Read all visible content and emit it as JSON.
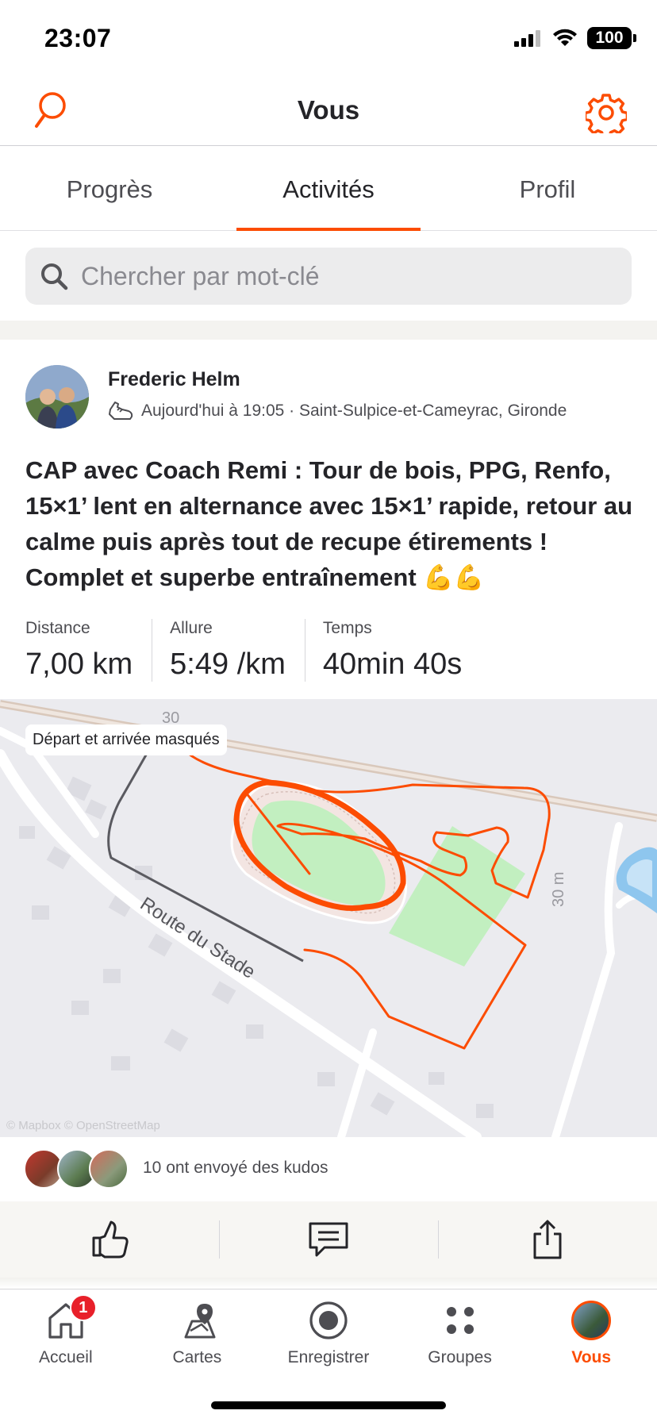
{
  "status_bar": {
    "time": "23:07",
    "battery": "100"
  },
  "header": {
    "title": "Vous"
  },
  "tabs": [
    {
      "label": "Progrès"
    },
    {
      "label": "Activités"
    },
    {
      "label": "Profil"
    }
  ],
  "search": {
    "placeholder": "Chercher par mot-clé"
  },
  "activity": {
    "athlete": "Frederic Helm",
    "meta": "Aujourd'hui à 19:05 · Saint-Sulpice-et-Cameyrac, Gironde",
    "title": "CAP avec Coach Remi : Tour de bois, PPG, Renfo, 15×1’ lent en alternance avec 15×1’ rapide, retour au calme puis après tout de recupe étirements ! Complet et superbe entraînement 💪💪",
    "stats": [
      {
        "label": "Distance",
        "value": "7,00 km"
      },
      {
        "label": "Allure",
        "value": "5:49 /km"
      },
      {
        "label": "Temps",
        "value": "40min 40s"
      }
    ],
    "map": {
      "badge": "Départ et arrivée masqués",
      "road_label": "Route du Stade",
      "elevation_top": "30",
      "elevation_right": "30 m",
      "attribution": "© Mapbox © OpenStreetMap",
      "route_color": "#fc4c02"
    },
    "kudos_text": "10 ont envoyé des kudos"
  },
  "nav": [
    {
      "label": "Accueil",
      "badge": "1"
    },
    {
      "label": "Cartes"
    },
    {
      "label": "Enregistrer"
    },
    {
      "label": "Groupes"
    },
    {
      "label": "Vous"
    }
  ],
  "colors": {
    "accent": "#fc4c02",
    "badge": "#e8202a"
  }
}
